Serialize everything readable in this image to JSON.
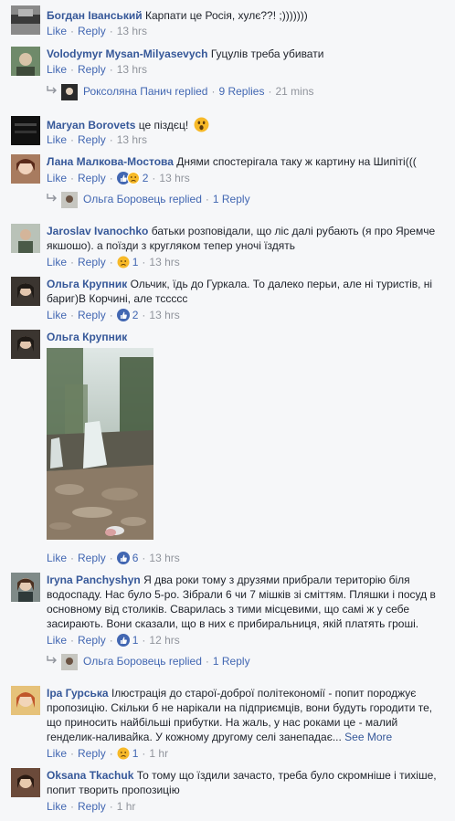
{
  "comments": [
    {
      "author": "Богдан Іванський",
      "text": "Карпати це Росія, хулє??! ;)))))))",
      "like": "Like",
      "reply": "Reply",
      "time": "13 hrs"
    },
    {
      "author": "Volodymyr Mysan-Milyasevych",
      "text": "Гуцулів треба убивати",
      "like": "Like",
      "reply": "Reply",
      "time": "13 hrs"
    },
    {
      "author": "Maryan Borovets",
      "text": "це піздєц!",
      "like": "Like",
      "reply": "Reply",
      "time": "13 hrs"
    },
    {
      "author": "Лана Малкова-Мостова",
      "text": "Днями спостерігала таку ж картину на Шипіті(((",
      "like": "Like",
      "reply": "Reply",
      "reactions": "2",
      "time": "13 hrs"
    },
    {
      "author": "Jaroslav Ivanochko",
      "text": "батьки розповідали, що ліс далі рубають (я про Яремче якшошо). а поїзди з кругляком тепер уночі їздять",
      "like": "Like",
      "reply": "Reply",
      "reactions": "1",
      "time": "13 hrs"
    },
    {
      "author": "Ольга Крупник",
      "text": "Ольчик, їдь до Гуркала. То далеко перьи, але ні туристів, ні бариг)В Корчині, але тссссс",
      "like": "Like",
      "reply": "Reply",
      "reactions": "2",
      "time": "13 hrs"
    },
    {
      "author": "Ольга Крупник",
      "text": "",
      "like": "Like",
      "reply": "Reply",
      "reactions": "6",
      "time": "13 hrs"
    },
    {
      "author": "Iryna Panchyshyn",
      "text": "Я два роки тому з друзями прибрали територію біля водоспаду. Нас було 5-ро. Зібрали 6 чи 7 мішків зі сміттям. Пляшки і посуд в основному від столиків. Сварилась з тими місцевими, що самі ж у себе засирають. Вони сказали, що в них є прибиральниця, якій платять гроші.",
      "like": "Like",
      "reply": "Reply",
      "reactions": "1",
      "time": "12 hrs"
    },
    {
      "author": "Іра Гурська",
      "text": "Ілюстрація до старої-доброї політекономії - попит породжує пропозицію. Скільки б не нарікали на підприємців, вони будуть городити те, що приносить найбільші прибутки. На жаль, у нас роками це - малий генделик-наливайка. У кожному другому селі занепадає...",
      "see_more": "See More",
      "like": "Like",
      "reply": "Reply",
      "reactions": "1",
      "time": "1 hr"
    },
    {
      "author": "Oksana Tkachuk",
      "text": "То тому що їздили зачасто, треба було скромніше і тихіше, попит творить пропозицію",
      "like": "Like",
      "reply": "Reply",
      "time": "1 hr"
    }
  ],
  "replies": [
    {
      "who": "Роксоляна Панич replied",
      "sep": "·",
      "count": "9 Replies",
      "time": "21 mins"
    },
    {
      "who": "Ольга Боровець replied",
      "sep": "·",
      "count": "1 Reply",
      "time": ""
    },
    {
      "who": "Ольга Боровець replied",
      "sep": "·",
      "count": "1 Reply",
      "time": ""
    }
  ],
  "dot": "·",
  "icons": {
    "reply_arrow": "reply-arrow-icon",
    "wow": "wow-reaction-icon",
    "sad": "sad-reaction-icon",
    "like": "like-reaction-icon"
  },
  "colors": {
    "author": "#365899",
    "link": "#4267b2",
    "meta": "#90949c",
    "background": "#f6f7f9"
  }
}
